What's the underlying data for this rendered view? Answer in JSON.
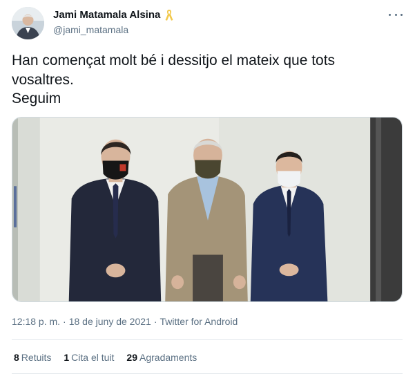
{
  "author": {
    "name": "Jami Matamala Alsina",
    "handle": "@jami_matamala",
    "badge_icon": "yellow-ribbon-icon",
    "badge_color": "#f2c94c"
  },
  "menu": {
    "icon": "more-options-icon"
  },
  "tweet": {
    "lines": [
      "Han començat molt bé i dessitjo el mateix que tots",
      "vosaltres.",
      "Seguim"
    ]
  },
  "meta": {
    "time": "12:18 p. m.",
    "date": "18 de juny de 2021",
    "source": "Twitter for Android",
    "separator": "·"
  },
  "stats": {
    "retweets": {
      "count": "8",
      "label": "Retuits"
    },
    "quotes": {
      "count": "1",
      "label": "Cita el tuit"
    },
    "likes": {
      "count": "29",
      "label": "Agradaments"
    }
  },
  "colors": {
    "text": "#0f1419",
    "secondary": "#5b7083",
    "divider": "#e3e8ec"
  }
}
